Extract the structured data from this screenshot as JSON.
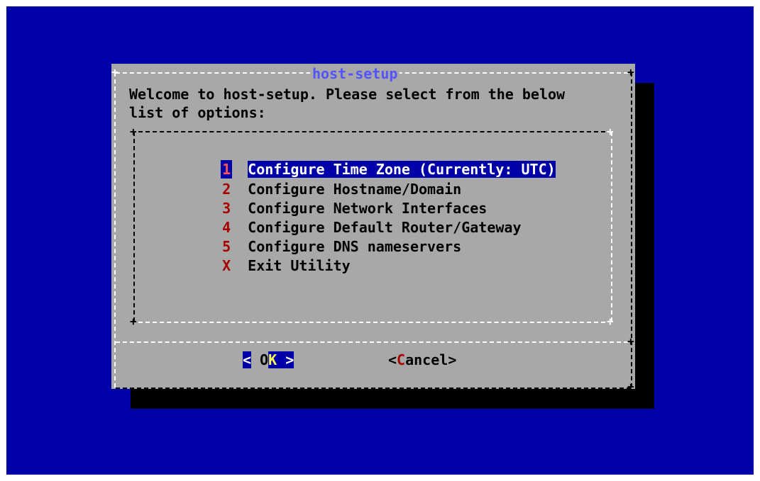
{
  "dialog": {
    "title": "host-setup",
    "prompt_line1": "Welcome to host-setup. Please select from the below",
    "prompt_line2": "list of options:"
  },
  "menu": {
    "items": [
      {
        "tag": "1",
        "label": "Configure Time Zone (Currently: UTC)",
        "selected": true
      },
      {
        "tag": "2",
        "label": "Configure Hostname/Domain"
      },
      {
        "tag": "3",
        "label": "Configure Network Interfaces"
      },
      {
        "tag": "4",
        "label": "Configure Default Router/Gateway"
      },
      {
        "tag": "5",
        "label": "Configure DNS nameservers"
      },
      {
        "tag": "X",
        "label": "Exit Utility"
      }
    ]
  },
  "buttons": {
    "ok": {
      "left": "<",
      "hot": "K",
      "pre": " O",
      "right": " >",
      "focused": true
    },
    "cancel": {
      "open": "<",
      "hot": "C",
      "rest": "ancel",
      "close": ">"
    }
  },
  "colors": {
    "background": "#0000a8",
    "dialog": "#a8a8a8",
    "title": "#5454fc",
    "tag": "#a80000",
    "highlight_bg": "#0000a8",
    "hotkey_ok": "#ffff54"
  }
}
